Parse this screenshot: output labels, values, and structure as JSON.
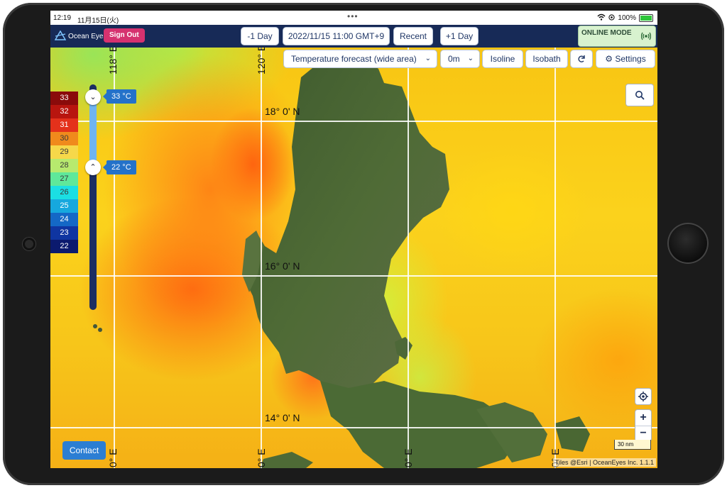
{
  "status_bar": {
    "time": "12:19",
    "date": "11月15日(火)",
    "battery": "100%"
  },
  "app_bar": {
    "logo_text": "Ocean Eyes",
    "sign_out": "Sign Out",
    "prev_day": "-1 Day",
    "datetime": "2022/11/15 11:00 GMT+9",
    "recent": "Recent",
    "next_day": "+1 Day",
    "online_mode": "ONLINE MODE"
  },
  "toolbar": {
    "layer_select": "Temperature forecast (wide area)",
    "depth_select": "0m",
    "isoline": "Isoline",
    "isobath": "Isobath",
    "settings": "Settings"
  },
  "legend": {
    "items": [
      {
        "label": "33",
        "color": "#8a0b0b"
      },
      {
        "label": "32",
        "color": "#b8150f"
      },
      {
        "label": "31",
        "color": "#e4311b"
      },
      {
        "label": "30",
        "color": "#f08a1c"
      },
      {
        "label": "29",
        "color": "#f6d84a"
      },
      {
        "label": "28",
        "color": "#b7ea6e"
      },
      {
        "label": "27",
        "color": "#5fe89a"
      },
      {
        "label": "26",
        "color": "#1bdfe3"
      },
      {
        "label": "25",
        "color": "#16a8de"
      },
      {
        "label": "24",
        "color": "#1468c6"
      },
      {
        "label": "23",
        "color": "#0f35a1"
      },
      {
        "label": "22",
        "color": "#0b1a6e"
      }
    ]
  },
  "slider": {
    "max_label": "33 °C",
    "min_label": "22 °C"
  },
  "grid": {
    "lat_labels": [
      "18° 0' N",
      "16° 0' N",
      "14° 0' N"
    ],
    "lon_labels": [
      "118° E",
      "120° E",
      "0° E",
      "0° E",
      "0° E",
      "0° E"
    ]
  },
  "map_controls": {
    "zoom_in": "+",
    "zoom_out": "−"
  },
  "contact": "Contact",
  "scale": "30 nm",
  "attribution": "Tiles @Esri | OceanEyes Inc. 1.1.1"
}
